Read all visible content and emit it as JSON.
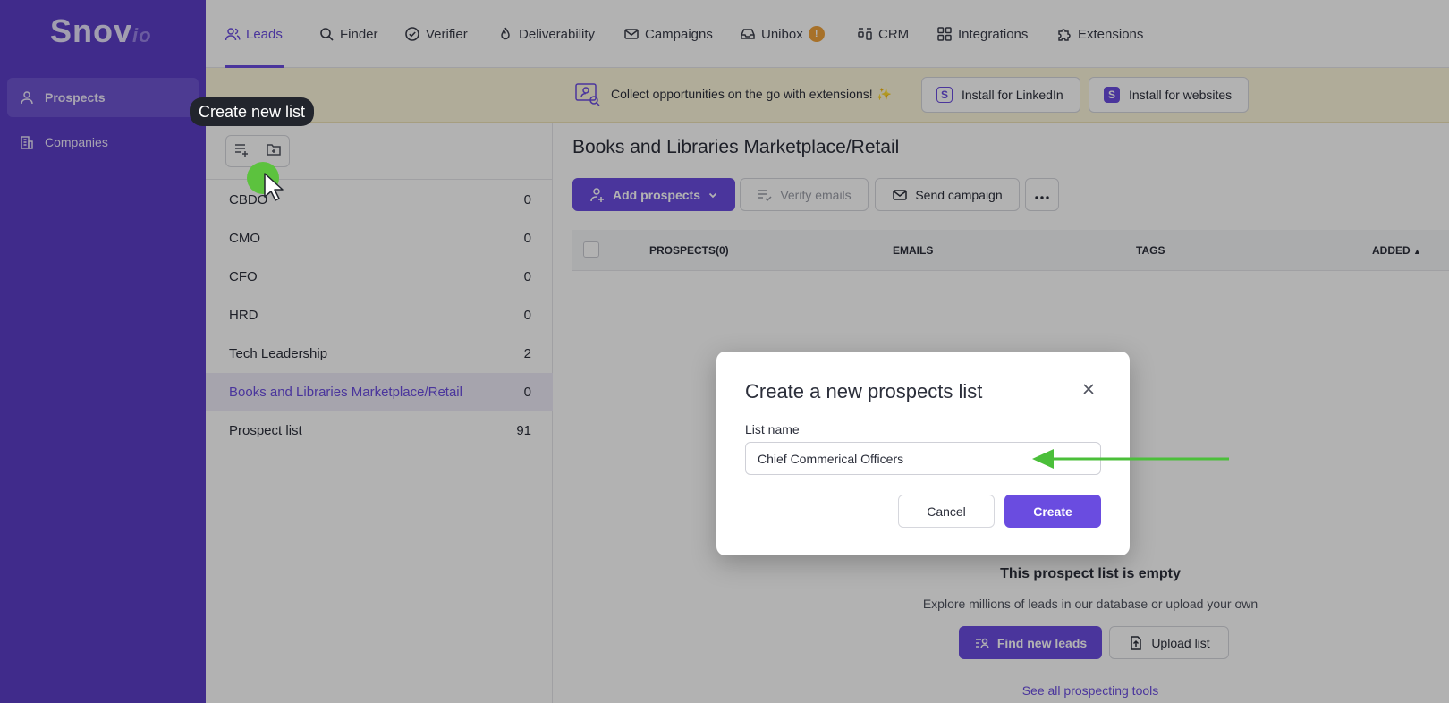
{
  "app": {
    "logo_main": "Snov",
    "logo_suffix": "io"
  },
  "sidebar": {
    "items": [
      {
        "label": "Prospects",
        "icon": "person-icon",
        "active": true
      },
      {
        "label": "Companies",
        "icon": "building-icon",
        "active": false
      }
    ]
  },
  "topnav": {
    "items": [
      {
        "label": "Leads",
        "icon": "users-icon",
        "active": true
      },
      {
        "label": "Finder",
        "icon": "search-icon"
      },
      {
        "label": "Verifier",
        "icon": "check-circle-icon"
      },
      {
        "label": "Deliverability",
        "icon": "flame-icon"
      },
      {
        "label": "Campaigns",
        "icon": "envelope-icon"
      },
      {
        "label": "Unibox",
        "icon": "inbox-icon",
        "badge": "!"
      },
      {
        "label": "CRM",
        "icon": "crm-icon"
      },
      {
        "label": "Integrations",
        "icon": "grid-icon"
      },
      {
        "label": "Extensions",
        "icon": "puzzle-icon"
      }
    ]
  },
  "banner": {
    "text": "Collect opportunities on the go with extensions! ✨",
    "linkedin_btn": "Install for LinkedIn",
    "websites_btn": "Install for websites"
  },
  "lists": {
    "items": [
      {
        "name": "CBDO",
        "count": "0"
      },
      {
        "name": "CMO",
        "count": "0"
      },
      {
        "name": "CFO",
        "count": "0"
      },
      {
        "name": "HRD",
        "count": "0"
      },
      {
        "name": "Tech Leadership",
        "count": "2"
      },
      {
        "name": "Books and Libraries Marketplace/Retail",
        "count": "0",
        "active": true
      },
      {
        "name": "Prospect list",
        "count": "91"
      }
    ]
  },
  "tooltip": {
    "text": "Create new list"
  },
  "main": {
    "title": "Books and Libraries Marketplace/Retail",
    "add_prospects": "Add prospects",
    "verify_emails": "Verify emails",
    "send_campaign": "Send campaign",
    "table_headers": {
      "prospects": "PROSPECTS(0)",
      "emails": "EMAILS",
      "tags": "TAGS",
      "added": "ADDED"
    },
    "empty_title": "This prospect list is empty",
    "empty_sub": "Explore millions of leads in our database or upload your own",
    "find_leads": "Find new leads",
    "upload_list": "Upload list",
    "see_all": "See all prospecting tools"
  },
  "modal": {
    "title": "Create a new prospects list",
    "field_label": "List name",
    "field_value": "Chief Commerical Officers",
    "cancel": "Cancel",
    "create": "Create"
  },
  "colors": {
    "brand": "#6a4ce0",
    "sidebar": "#5c3ec7",
    "annotation": "#4bbf3a"
  }
}
